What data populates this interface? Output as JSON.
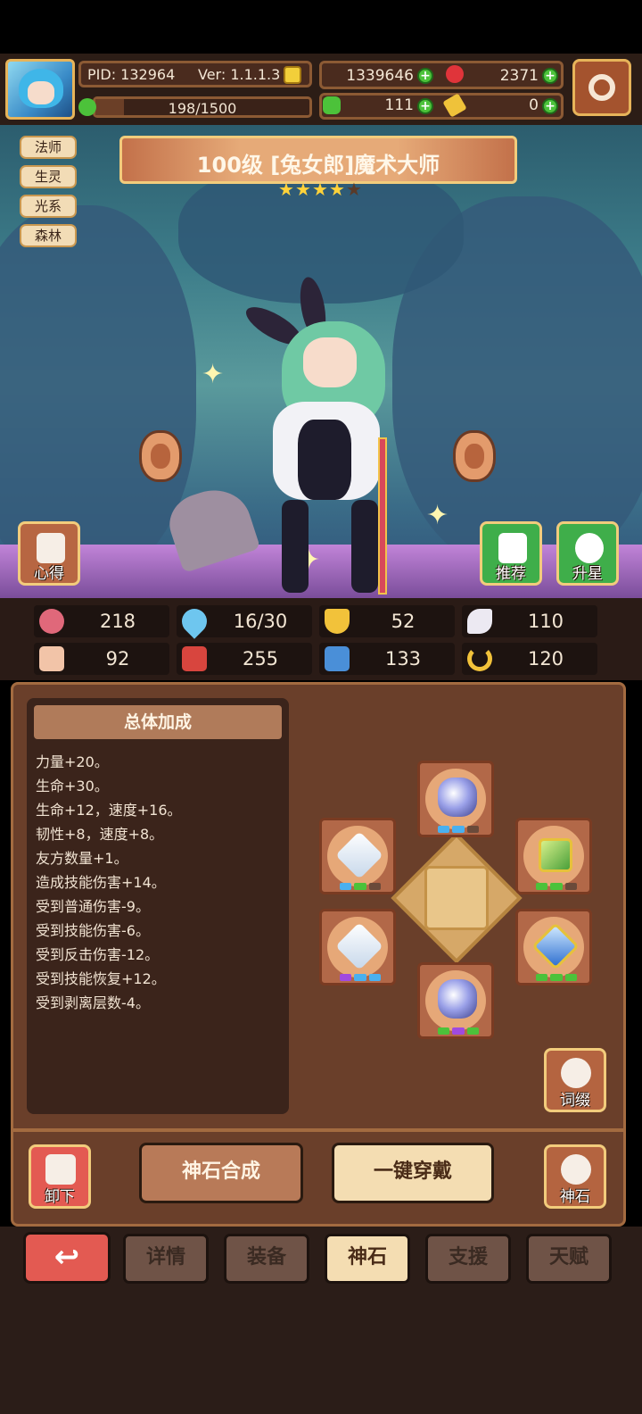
{
  "header": {
    "pid": "PID: 132964",
    "version": "Ver: 1.1.1.3",
    "exp": "198/1500",
    "exp_progress": 0.132,
    "coins": "1339646",
    "gems": "2371",
    "clover": "111",
    "tickets": "0"
  },
  "character": {
    "title": "100级 [兔女郎]魔术大师",
    "stars_filled": 4,
    "stars_total": 5,
    "tags": [
      "法师",
      "生灵",
      "光系",
      "森林"
    ]
  },
  "scene_buttons": {
    "insight": "心得",
    "recommend": "推荐",
    "star_up": "升星"
  },
  "stats": {
    "hp": "218",
    "mana": "16/30",
    "defense": "52",
    "speed": "110",
    "strength": "92",
    "intellect": "255",
    "skill": "133",
    "luck": "120"
  },
  "bonus": {
    "heading": "总体加成",
    "lines": [
      "力量+20。",
      "生命+30。",
      "生命+12，速度+16。",
      "韧性+8，速度+8。",
      "友方数量+1。",
      "造成技能伤害+14。",
      "受到普通伤害-9。",
      "受到技能伤害-6。",
      "受到反击伤害-12。",
      "受到技能恢复+12。",
      "受到剥离层数-4。"
    ]
  },
  "panel_buttons": {
    "affix": "词缀",
    "unequip": "卸下",
    "synthesize": "神石合成",
    "equip_all": "一键穿戴",
    "god_stone": "神石"
  },
  "nav": {
    "back": "↩",
    "tabs": [
      "详情",
      "装备",
      "神石",
      "支援",
      "天赋"
    ],
    "active_tab": "神石"
  },
  "colors": {
    "accent_gold": "#f2cc7c",
    "panel_brown": "#6a3f2a",
    "back_red": "#e35a52",
    "green_button": "#3fae4a"
  }
}
